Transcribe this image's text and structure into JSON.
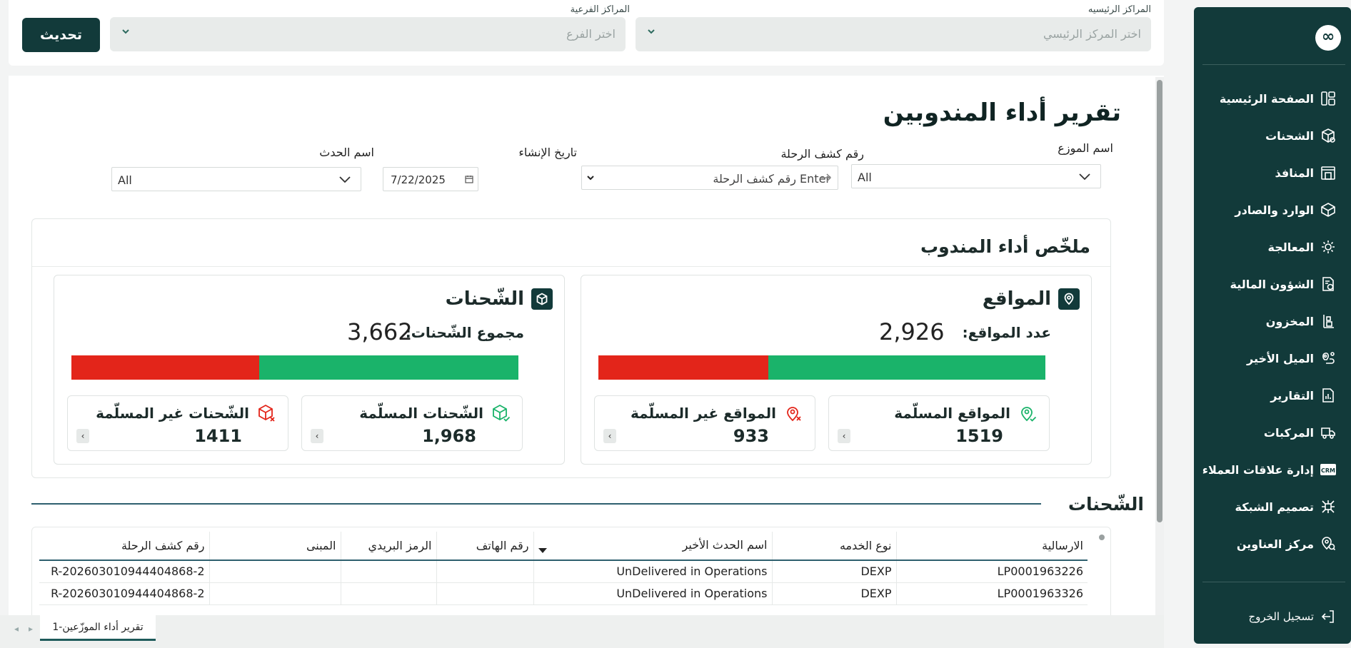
{
  "sidebar": {
    "logo": "∞",
    "items": [
      {
        "label": "الصفحة الرئيسية",
        "icon": "dashboard-icon"
      },
      {
        "label": "الشحنات",
        "icon": "package-icon"
      },
      {
        "label": "المنافذ",
        "icon": "outlet-icon"
      },
      {
        "label": "الوارد والصادر",
        "icon": "inbound-outbound-icon"
      },
      {
        "label": "المعالجة",
        "icon": "processing-icon"
      },
      {
        "label": "الشؤون المالية",
        "icon": "finance-icon"
      },
      {
        "label": "المخزون",
        "icon": "inventory-icon"
      },
      {
        "label": "الميل الأخير",
        "icon": "last-mile-icon"
      },
      {
        "label": "التقارير",
        "icon": "reports-icon"
      },
      {
        "label": "المركبات",
        "icon": "truck-icon"
      },
      {
        "label": "إدارة علاقات العملاء",
        "icon": "crm-icon"
      },
      {
        "label": "تصميم الشبكة",
        "icon": "network-icon"
      },
      {
        "label": "مركز العناوين",
        "icon": "address-icon"
      }
    ],
    "logout": "تسجيل الخروج"
  },
  "topbar": {
    "main_center_label": "المراكز الرئيسيه",
    "main_center_placeholder": "اختر المركز الرئيسي",
    "branch_label": "المراكز الفرعية",
    "branch_placeholder": "اختر الفرع",
    "refresh": "تحديث"
  },
  "page": {
    "title": "تقرير أداء المندوبين",
    "filters": {
      "distributor_label": "اسم الموزع",
      "distributor_value": "All",
      "trip_label": "رقم كشف الرحلة",
      "trip_placeholder": "Enter رقم كشف الرحلة",
      "date_label": "تاريخ الإنشاء",
      "date_value": "7/22/2025",
      "event_label": "اسم الحدث",
      "event_value": "All"
    }
  },
  "summary": {
    "title": "ملخّص أداء المندوب",
    "locations": {
      "title": "المواقع",
      "total_label": "عدد المواقع:",
      "total": "2,926",
      "delivered_label": "المواقع المسلّمة",
      "delivered": "1519",
      "undelivered_label": "المواقع غير المسلّمة",
      "undelivered": "933",
      "delivered_fraction": 0.62
    },
    "shipments": {
      "title": "الشّحنات",
      "total_label": "مجموع الشّحنات:",
      "total": "3,662",
      "delivered_label": "الشّحنات المسلّمة",
      "delivered": "1,968",
      "undelivered_label": "الشّحنات غير المسلّمة",
      "undelivered": "1411",
      "delivered_fraction": 0.58
    },
    "colors": {
      "delivered": "#1ab36a",
      "undelivered": "#e3251a",
      "brand": "#123a3a"
    }
  },
  "shipments_table": {
    "title": "الشّحنات",
    "columns": [
      "الارسالية",
      "نوع الخدمه",
      "اسم الحدث الأخير",
      "رقم الهاتف",
      "الرمز البريدي",
      "المبنى",
      "رقم كشف الرحلة"
    ],
    "rows": [
      [
        "LP0001963226",
        "DEXP",
        "UnDelivered in Operations",
        "",
        "",
        "",
        "R-202603010944404868-2"
      ],
      [
        "LP0001963326",
        "DEXP",
        "UnDelivered in Operations",
        "",
        "",
        "",
        "R-202603010944404868-2"
      ]
    ]
  },
  "tabs": {
    "active": "تقرير أداء الموزّعين-1"
  }
}
